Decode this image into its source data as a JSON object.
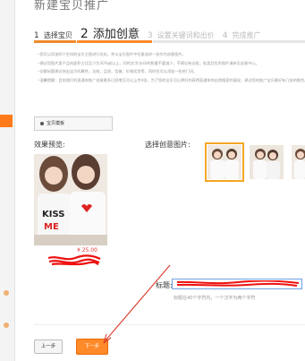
{
  "page": {
    "title": "新建宝贝推广"
  },
  "steps": [
    {
      "num": "1",
      "label": "选择宝贝",
      "state": "done"
    },
    {
      "num": "2",
      "label": "添加创意",
      "state": "active"
    },
    {
      "num": "3",
      "label": "设置关键词和出价",
      "state": "todo"
    },
    {
      "num": "4",
      "label": "完成推广",
      "state": "todo"
    }
  ],
  "tips": [
    "您可以添加四个空间的宝贝主图进行优化，并从宝贝图片中任意选择一张作为创意图片。",
    "建议您图片里产品的面积占比至少为30%或以上，同时文字/水印的数量不要减少，不建议有边框，各类目优秀图片请参见创意中心。",
    "创意标题建议突出宝贝的属性，功效，品质，信誉，价格优势等，同时也可以添加一些热门词。",
    "温馨提醒：目前我们的直通车推广创意最多已经增至可以上传4张，为了您的宝贝可以更好的获得直通车和自然搜索的展现，建议您的推广宝贝最好有几张的换色。并多创意也可以为您的宝贝测试带来的不同点击效果，可以根据测试数据来优化您的创意。"
  ],
  "template": {
    "label": "宝贝模板"
  },
  "preview": {
    "label": "效果预览:",
    "price": "¥ 25.00",
    "image_alt": "两名身穿印有 KISS ME 字样白色T恤的女孩"
  },
  "creative_picker": {
    "label": "选择创意图片:",
    "selected_index": 0
  },
  "headline": {
    "label": "标题:",
    "hint": "标题在40个字符内，一个汉字为两个字符"
  },
  "buttons": {
    "prev": "上一步",
    "next": "下一步"
  },
  "colors": {
    "accent": "#ff8a2a",
    "price": "#ee3333",
    "input_border": "#6fa1e3",
    "thumb_selected": "#f5a623",
    "annotation": "#d93a2b"
  },
  "icons": [
    "radio-dot-icon",
    "annotation-arrow-icon"
  ]
}
